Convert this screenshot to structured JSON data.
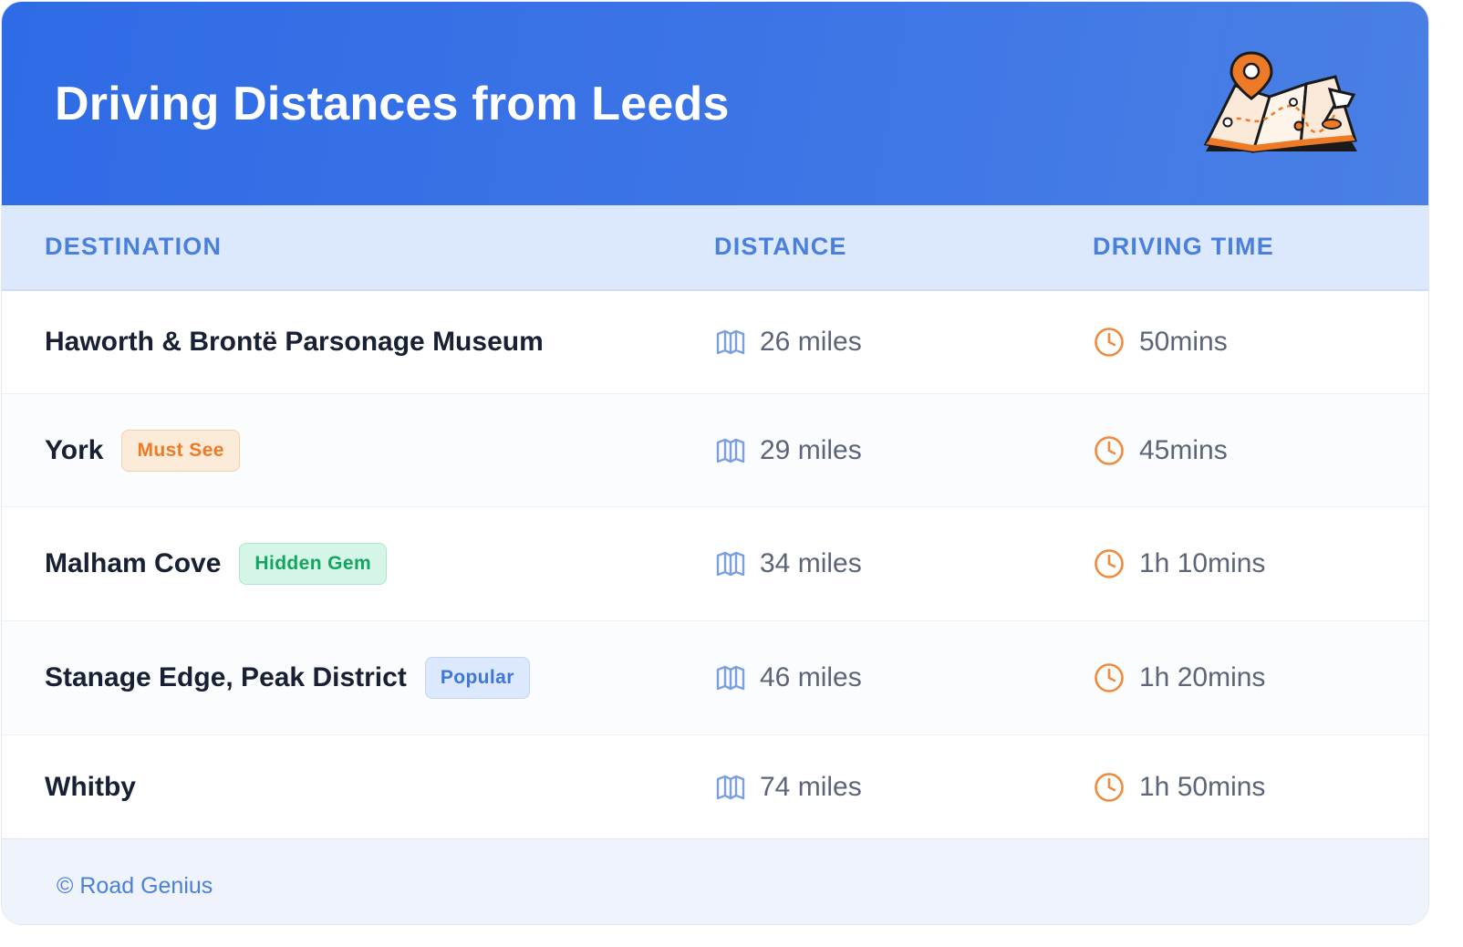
{
  "header": {
    "title": "Driving Distances from Leeds",
    "illustration_icon": "folded-map-with-location-pin-icon",
    "colors": {
      "gradient_start": "#2f6be6",
      "gradient_end": "#4a80e4",
      "title": "#ffffff"
    }
  },
  "table": {
    "columns": [
      "DESTINATION",
      "DISTANCE",
      "DRIVING TIME"
    ],
    "distance_icon": "map-icon",
    "time_icon": "clock-icon",
    "rows": [
      {
        "destination": "Haworth & Brontë Parsonage Museum",
        "badge": "",
        "distance": "26 miles",
        "time": "50mins"
      },
      {
        "destination": "York",
        "badge": "Must See",
        "badge_color": "orange",
        "distance": "29 miles",
        "time": "45mins"
      },
      {
        "destination": "Malham Cove",
        "badge": "Hidden Gem",
        "badge_color": "green",
        "distance": "34 miles",
        "time": "1h 10mins"
      },
      {
        "destination": "Stanage Edge, Peak District",
        "badge": "Popular",
        "badge_color": "blue",
        "distance": "46 miles",
        "time": "1h 20mins"
      },
      {
        "destination": "Whitby",
        "badge": "",
        "distance": "74 miles",
        "time": "1h 50mins"
      }
    ]
  },
  "colors": {
    "header_text": "#4a7fdb",
    "map_icon": "#7b9fe0",
    "clock_icon": "#f08a3c",
    "badge_orange": "#ec7a26",
    "badge_green": "#15a362",
    "badge_blue": "#3f77d8"
  },
  "footer": {
    "credit": "© Road Genius"
  }
}
